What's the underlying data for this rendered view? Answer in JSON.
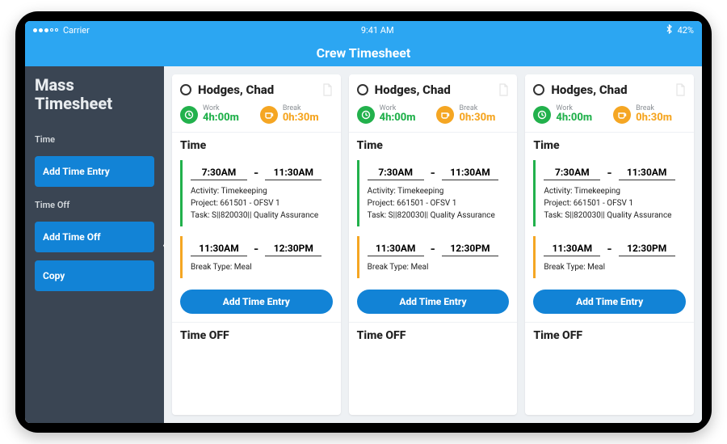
{
  "status": {
    "carrier": "Carrier",
    "time": "9:41 AM",
    "battery": "42%"
  },
  "title": "Crew Timesheet",
  "sidebar": {
    "heading_l1": "Mass",
    "heading_l2": "Timesheet",
    "sec_time": "Time",
    "btn_add_time": "Add Time Entry",
    "sec_off": "Time Off",
    "btn_add_off": "Add Time Off",
    "btn_copy": "Copy"
  },
  "employee": {
    "name": "Hodges, Chad",
    "work_label": "Work",
    "work_value": "4h:00m",
    "break_label": "Break",
    "break_value": "0h:30m",
    "section_time": "Time",
    "section_off": "Time OFF",
    "work_start": "7:30AM",
    "work_end": "11:30AM",
    "activity_k": "Activity:",
    "activity_v": "Timekeeping",
    "project_k": "Project:",
    "project_v": "661501 - OFSV 1",
    "task_k": "Task:",
    "task_v": "S||820030|| Quality Assurance",
    "break_start": "11:30AM",
    "break_end": "12:30PM",
    "breaktype_k": "Break Type:",
    "breaktype_v": "Meal",
    "add_btn": "Add Time Entry"
  }
}
